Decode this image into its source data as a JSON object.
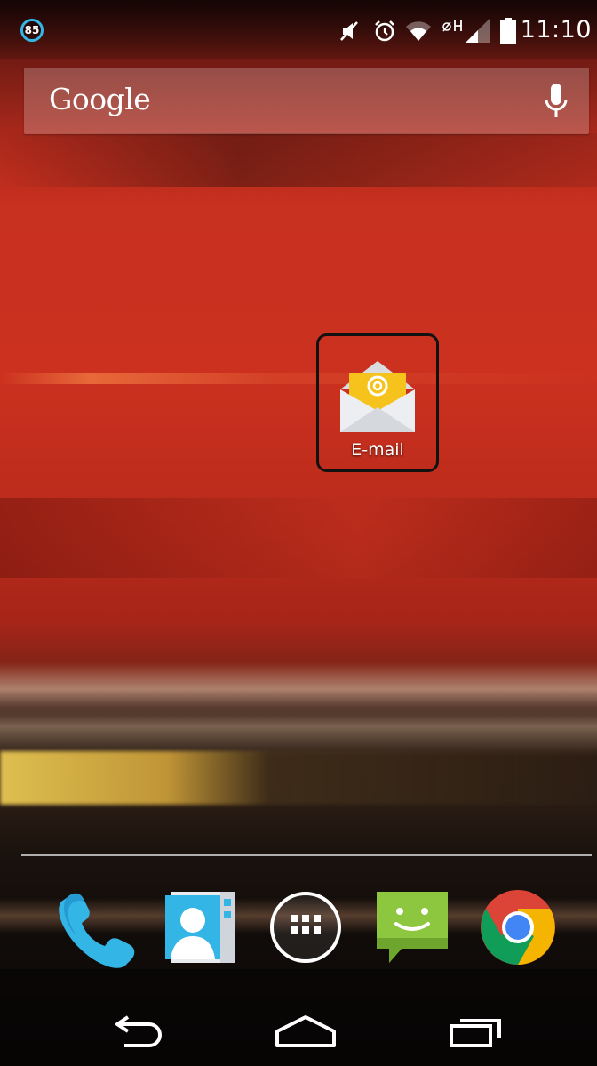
{
  "status_bar": {
    "notification_count": "85",
    "time": "11:10",
    "icons": [
      "notification-count-icon",
      "mute-icon",
      "alarm-icon",
      "wifi-icon",
      "data-icon",
      "signal-icon",
      "battery-icon"
    ]
  },
  "search": {
    "logo_text": "Google",
    "icon": "mic-icon"
  },
  "home": {
    "apps": [
      {
        "label": "E-mail",
        "icon": "email-icon"
      }
    ]
  },
  "dock": {
    "items": [
      {
        "icon": "phone-icon"
      },
      {
        "icon": "contacts-icon"
      },
      {
        "icon": "app-drawer-icon"
      },
      {
        "icon": "messaging-icon"
      },
      {
        "icon": "chrome-icon"
      }
    ]
  },
  "nav_bar": {
    "items": [
      {
        "icon": "back-icon"
      },
      {
        "icon": "home-icon"
      },
      {
        "icon": "recents-icon"
      }
    ]
  },
  "colors": {
    "notification_accent": "#36b5e5",
    "wallpaper_red": "#cc311f",
    "email_yellow": "#f6c31c",
    "messaging_green": "#8dc63f",
    "phone_blue": "#33b5e5"
  }
}
